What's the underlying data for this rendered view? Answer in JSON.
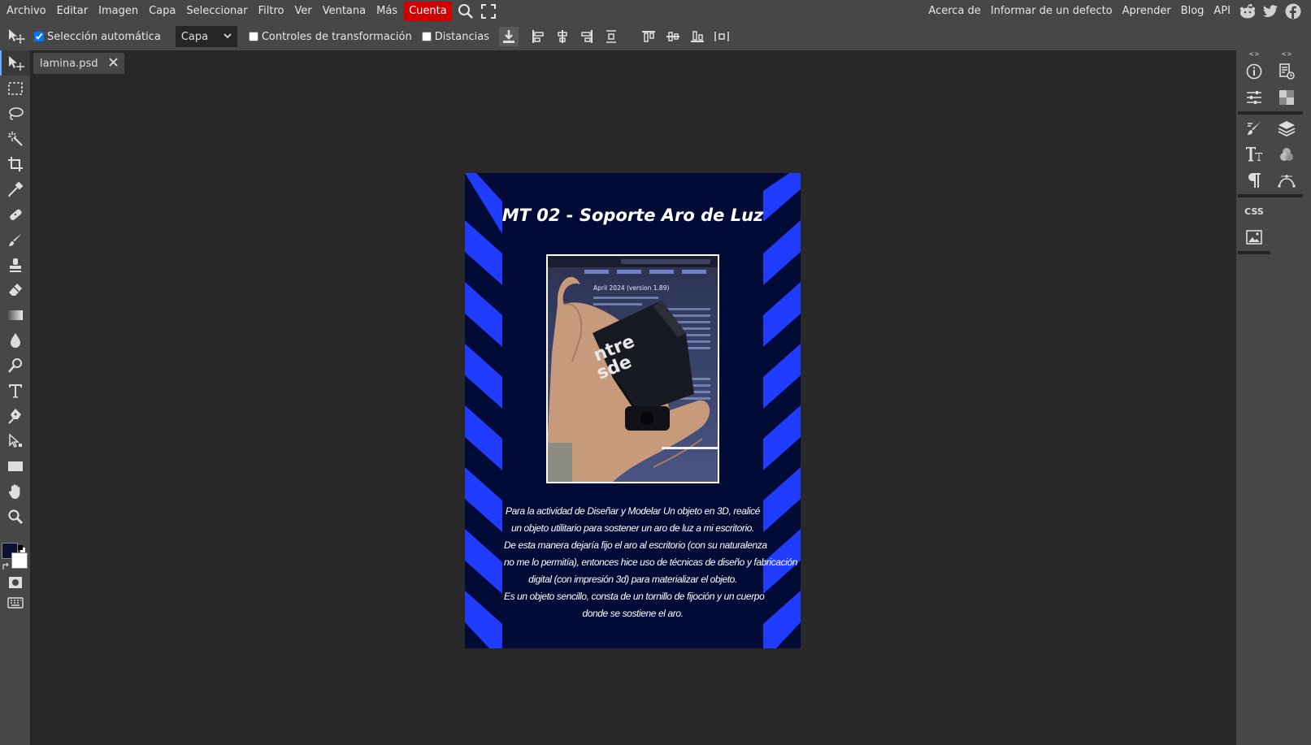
{
  "menu": {
    "items": [
      "Archivo",
      "Editar",
      "Imagen",
      "Capa",
      "Seleccionar",
      "Filtro",
      "Ver",
      "Ventana",
      "Más"
    ],
    "account": "Cuenta",
    "right_links": [
      "Acerca de",
      "Informar de un defecto",
      "Aprender",
      "Blog",
      "API"
    ]
  },
  "options": {
    "auto_select_label": "Selección automática",
    "auto_select_checked": true,
    "layer_select_value": "Capa",
    "transform_label": "Controles de transformación",
    "transform_checked": false,
    "distances_label": "Distancias",
    "distances_checked": false
  },
  "tools": [
    "move",
    "marquee",
    "lasso",
    "magic-wand",
    "crop",
    "eyedropper",
    "healing",
    "brush",
    "stamp",
    "eraser",
    "gradient",
    "blur",
    "dodge",
    "type",
    "pen",
    "path-select",
    "shape",
    "hand",
    "zoom"
  ],
  "colors": {
    "foreground": "#0d1130",
    "background": "#ffffff",
    "accent": "#6aa7ff",
    "account_red": "#d10000",
    "stripe_blue": "#1f3cff",
    "poster_bg": "#020a36"
  },
  "document": {
    "tab_name": "lamina.psd",
    "poster_title": "MT 02 - Soporte Aro de Luz",
    "photo_embossed_text": [
      "ntre",
      "sde"
    ],
    "photo_screen_heading": "April 2024 (version 1.89)",
    "body_lines": [
      "Para la actividad de Diseñar y Modelar Un objeto en 3D, realicé",
      "un objeto utilitario para sostener un aro de luz a mi escritorio.",
      "De esta manera dejaría fijo el aro al escritorio (con su naturalenza",
      "no me lo permitía), entonces hice uso de técnicas de diseño y fabricación",
      "digital (con impresión 3d) para materializar el objeto.",
      "Es un objeto sencillo, consta de un tornillo de fijoción y un cuerpo",
      "donde se sostiene el aro."
    ]
  },
  "right_panel": {
    "css_label": "CSS"
  }
}
